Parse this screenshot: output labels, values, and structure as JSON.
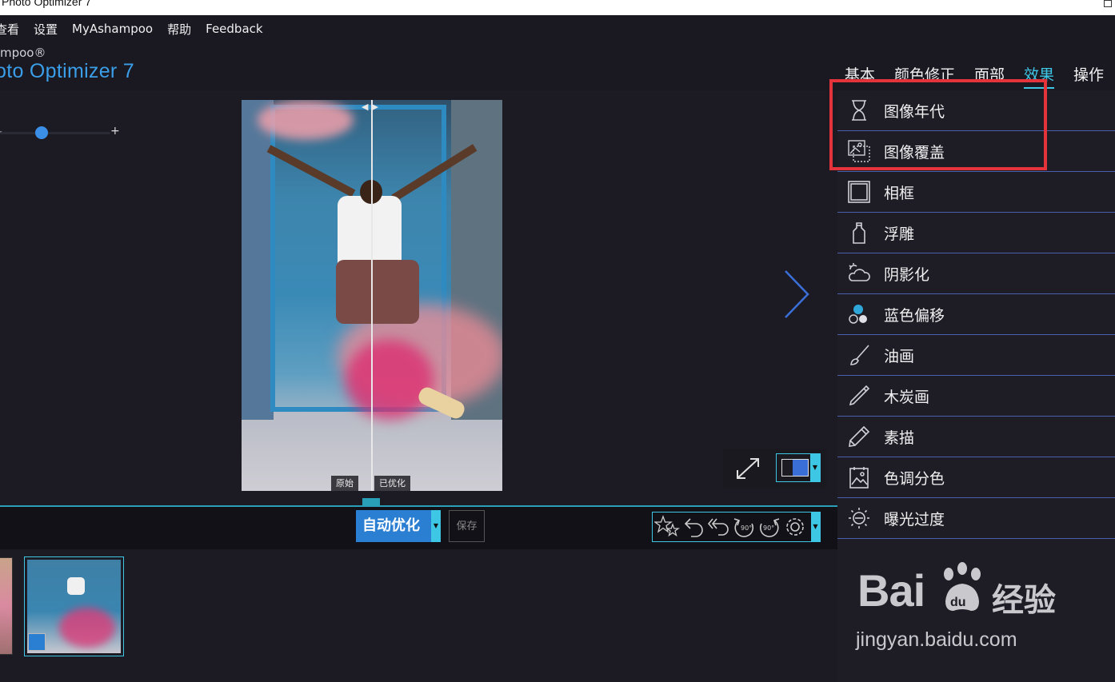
{
  "window": {
    "title": "Photo Optimizer 7"
  },
  "menu": {
    "items": [
      "查看",
      "设置",
      "MyAshampoo",
      "帮助",
      "Feedback"
    ]
  },
  "brand": {
    "small": "mpoo®",
    "big": "oto Optimizer 7"
  },
  "tabs": [
    {
      "label": "基本",
      "active": false
    },
    {
      "label": "颜色修正",
      "active": false
    },
    {
      "label": "面部",
      "active": false
    },
    {
      "label": "效果",
      "active": true
    },
    {
      "label": "操作",
      "active": false
    }
  ],
  "zoom": {
    "minus": "–",
    "plus": "+"
  },
  "preview": {
    "label_original": "原始",
    "label_optimized": "已优化"
  },
  "actions": {
    "auto_label": "自动优化",
    "save_label": "保存"
  },
  "effects": {
    "items": [
      {
        "label": "图像年代",
        "icon": "hourglass-icon"
      },
      {
        "label": "图像覆盖",
        "icon": "image-overlay-icon"
      },
      {
        "label": "相框",
        "icon": "frame-icon"
      },
      {
        "label": "浮雕",
        "icon": "emboss-icon"
      },
      {
        "label": "阴影化",
        "icon": "cloud-shadow-icon"
      },
      {
        "label": "蓝色偏移",
        "icon": "color-dots-icon"
      },
      {
        "label": "油画",
        "icon": "paintbrush-icon"
      },
      {
        "label": "木炭画",
        "icon": "charcoal-icon"
      },
      {
        "label": "素描",
        "icon": "pencil-icon"
      },
      {
        "label": "色调分色",
        "icon": "posterize-icon"
      },
      {
        "label": "曝光过度",
        "icon": "sun-icon"
      }
    ]
  },
  "watermark": {
    "logo": "Bai",
    "logo2": "du",
    "cn": "经验",
    "url": "jingyan.baidu.com"
  },
  "colors": {
    "accent": "#3ec7e4",
    "brand_blue": "#3a9ee8",
    "highlight_red": "#e5333b",
    "divider": "#4a5fb0"
  }
}
